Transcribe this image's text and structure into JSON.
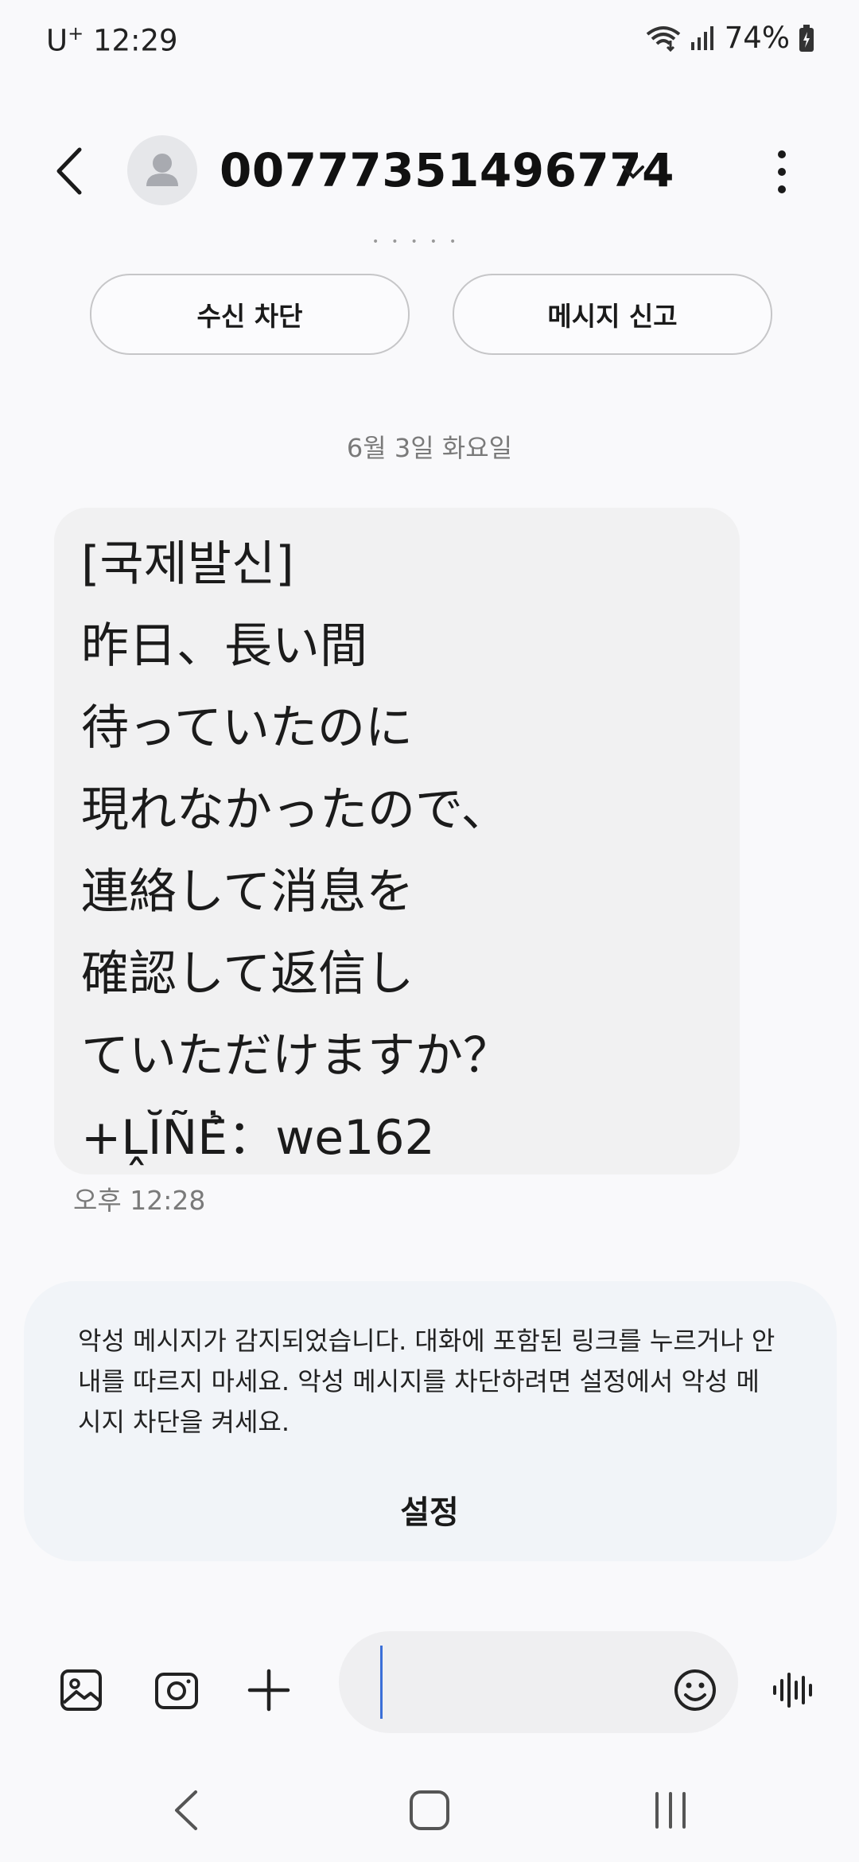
{
  "status": {
    "carrier": "U",
    "carrier_sup": "+",
    "time": "12:29",
    "battery": "74%"
  },
  "header": {
    "contact": "00777351496774",
    "icons": [
      "back-arrow-icon",
      "avatar-icon",
      "chevron-down-icon",
      "more-vert-icon"
    ]
  },
  "actions": {
    "block": "수신 차단",
    "report": "메시지 신고"
  },
  "date_separator": "6월 3일 화요일",
  "message": {
    "lines": [
      "[국제발신]",
      "昨日、長い間",
      "待っていたのに",
      "現れなかったので、",
      "連絡して消息を",
      "確認して返信し",
      "ていただけますか？",
      "+ḼĬÑĖ̉：we162"
    ],
    "time": "오후 12:28"
  },
  "warning": {
    "text": "악성 메시지가 감지되었습니다. 대화에 포함된 링크를 누르거나 안내를 따르지 마세요. 악성 메시지를 차단하려면 설정에서 악성 메시지 차단을 켜세요.",
    "button": "설정"
  },
  "composer": {
    "placeholder": "",
    "icons": [
      "gallery-icon",
      "camera-icon",
      "add-icon",
      "emoji-icon",
      "voice-icon"
    ]
  },
  "navbar": {
    "icons": [
      "nav-back-icon",
      "nav-home-icon",
      "nav-recents-icon"
    ]
  },
  "colors": {
    "background": "#f9f9fb",
    "bubble": "#f1f1f2",
    "warning_card": "#f1f4f8",
    "cursor": "#3b6fd8"
  }
}
